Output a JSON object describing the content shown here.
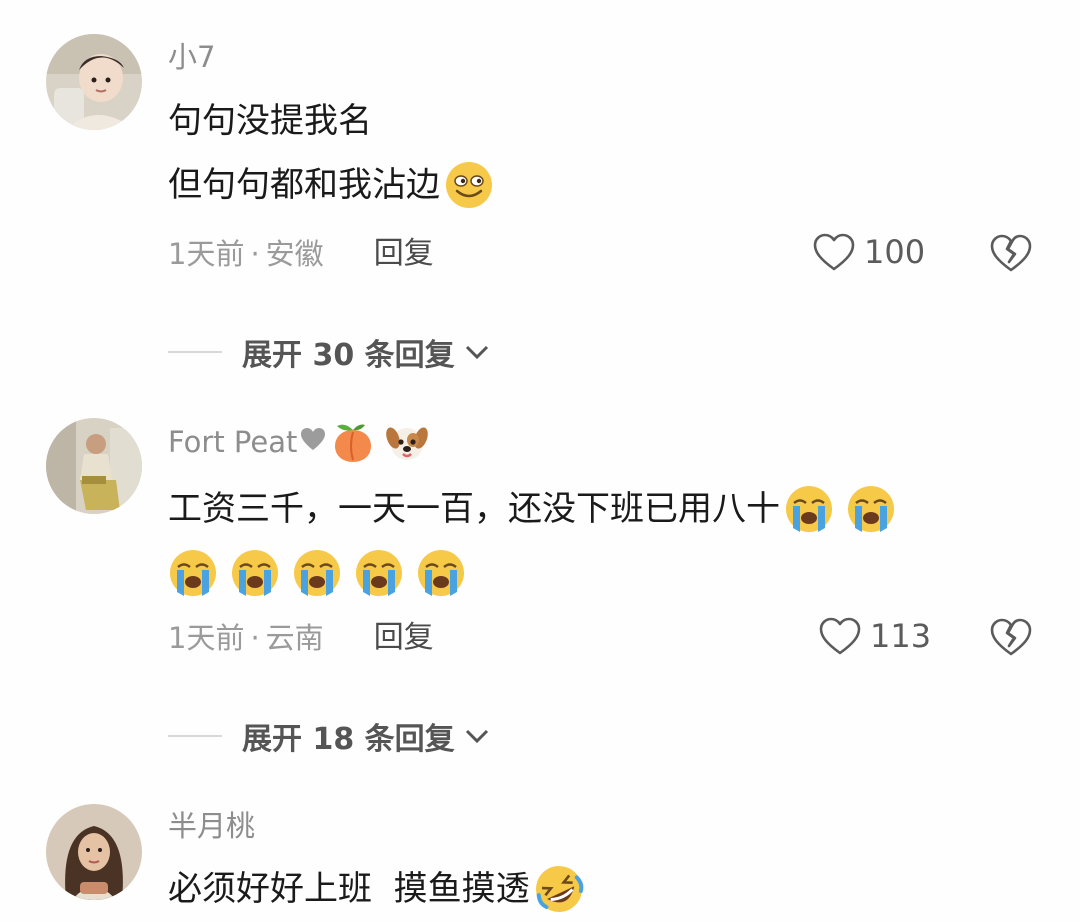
{
  "comments": [
    {
      "username": "小7",
      "lines": [
        "句句没提我名",
        "但句句都和我沾边"
      ],
      "line_emoji": "smirk-face-emoji",
      "time": "1天前",
      "location": "安徽",
      "separator": "·",
      "reply_label": "回复",
      "likes": "100",
      "expand_label": "展开 30 条回复"
    },
    {
      "username": "Fort Peat",
      "name_badges": [
        "gray-heart-emoji",
        "peach-emoji",
        "dog-face-emoji"
      ],
      "lines": [
        "工资三千，一天一百，还没下班已用八十"
      ],
      "trailing_emoji_count": 7,
      "trailing_emoji": "loudly-crying-face-emoji",
      "time": "1天前",
      "location": "云南",
      "separator": "·",
      "reply_label": "回复",
      "likes": "113",
      "expand_label": "展开 18 条回复"
    },
    {
      "username": "半月桃",
      "lines": [
        "必须好好上班  摸鱼摸透"
      ],
      "line_emoji": "rolling-on-floor-laughing-emoji"
    }
  ],
  "colors": {
    "background": "#fefefe",
    "username": "#8d8d8d",
    "meta": "#9a9a9a",
    "emoji_yellow": "#f7c948",
    "tears_blue": "#4aa3e0"
  }
}
